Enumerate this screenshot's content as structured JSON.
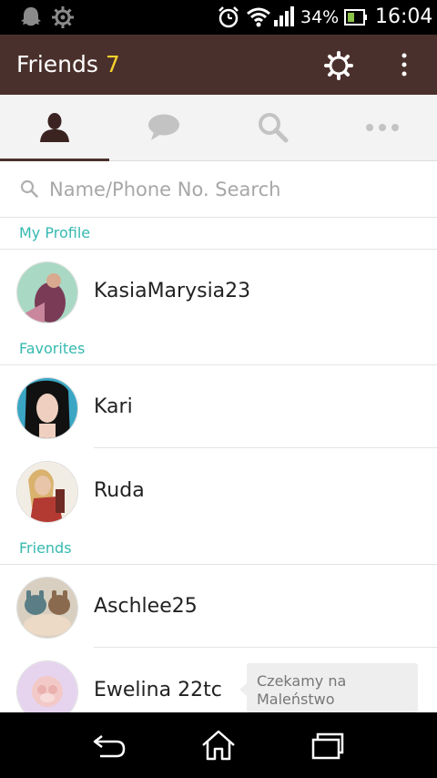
{
  "status_bar": {
    "battery_percent": "34%",
    "time": "16:04"
  },
  "app_bar": {
    "title": "Friends",
    "count": "7"
  },
  "tabs": [
    {
      "icon": "person-icon",
      "active": true
    },
    {
      "icon": "chat-bubble-icon",
      "active": false
    },
    {
      "icon": "search-icon",
      "active": false
    },
    {
      "icon": "more-dots-icon",
      "active": false
    }
  ],
  "search": {
    "placeholder": "Name/Phone No. Search"
  },
  "sections": {
    "my_profile": "My Profile",
    "favorites": "Favorites",
    "friends": "Friends"
  },
  "profile": {
    "name": "KasiaMarysia23"
  },
  "favorites": [
    {
      "name": "Kari"
    },
    {
      "name": "Ruda"
    }
  ],
  "friends": [
    {
      "name": "Aschlee25"
    },
    {
      "name": "Ewelina 22tc",
      "status_message": "Czekamy na Maleństwo"
    }
  ],
  "colors": {
    "app_bar": "#4a302c",
    "accent_count": "#f5d12d",
    "section_label": "#35b9b0"
  }
}
